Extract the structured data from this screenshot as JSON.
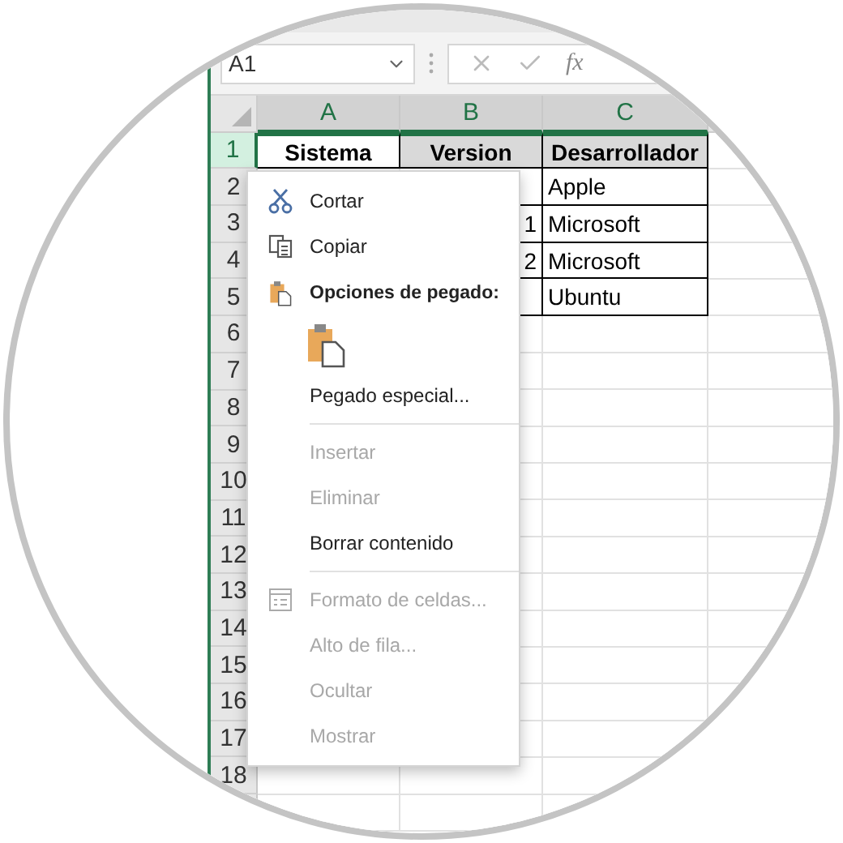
{
  "name_box": "A1",
  "formula_bar": {
    "fx": "fx"
  },
  "columns": [
    {
      "label": "A",
      "selected": true
    },
    {
      "label": "B",
      "selected": true
    },
    {
      "label": "C",
      "selected": true
    }
  ],
  "rows": [
    {
      "number": "1",
      "selected": true,
      "cells": {
        "a": "Sistema",
        "b": "Version",
        "c": "Desarrollador"
      }
    },
    {
      "number": "2",
      "selected": false,
      "cells": {
        "c": "Apple"
      }
    },
    {
      "number": "3",
      "selected": false,
      "cells": {
        "b": "1",
        "c": "Microsoft"
      }
    },
    {
      "number": "4",
      "selected": false,
      "cells": {
        "b": "2",
        "c": "Microsoft"
      }
    },
    {
      "number": "5",
      "selected": false,
      "cells": {
        "c": "Ubuntu"
      }
    },
    {
      "number": "6",
      "selected": false,
      "cells": {}
    },
    {
      "number": "7",
      "selected": false,
      "cells": {}
    },
    {
      "number": "8",
      "selected": false,
      "cells": {}
    },
    {
      "number": "9",
      "selected": false,
      "cells": {}
    },
    {
      "number": "10",
      "selected": false,
      "cells": {}
    },
    {
      "number": "11",
      "selected": false,
      "cells": {}
    },
    {
      "number": "12",
      "selected": false,
      "cells": {}
    },
    {
      "number": "13",
      "selected": false,
      "cells": {}
    },
    {
      "number": "14",
      "selected": false,
      "cells": {}
    },
    {
      "number": "15",
      "selected": false,
      "cells": {}
    },
    {
      "number": "16",
      "selected": false,
      "cells": {}
    },
    {
      "number": "17",
      "selected": false,
      "cells": {}
    },
    {
      "number": "18",
      "selected": false,
      "cells": {}
    }
  ],
  "context_menu": [
    {
      "kind": "item",
      "label": "Cortar",
      "disabled": false
    },
    {
      "kind": "item",
      "label": "Copiar",
      "disabled": false
    },
    {
      "kind": "heading",
      "label": "Opciones de pegado:"
    },
    {
      "kind": "paste"
    },
    {
      "kind": "item",
      "label": "Pegado especial...",
      "disabled": false
    },
    {
      "kind": "separator"
    },
    {
      "kind": "item",
      "label": "Insertar",
      "disabled": true
    },
    {
      "kind": "item",
      "label": "Eliminar",
      "disabled": true
    },
    {
      "kind": "item",
      "label": "Borrar contenido",
      "disabled": false
    },
    {
      "kind": "separator"
    },
    {
      "kind": "item",
      "label": "Formato de celdas...",
      "disabled": true
    },
    {
      "kind": "item",
      "label": "Alto de fila...",
      "disabled": true
    },
    {
      "kind": "item",
      "label": "Ocultar",
      "disabled": true
    },
    {
      "kind": "item",
      "label": "Mostrar",
      "disabled": true
    }
  ]
}
